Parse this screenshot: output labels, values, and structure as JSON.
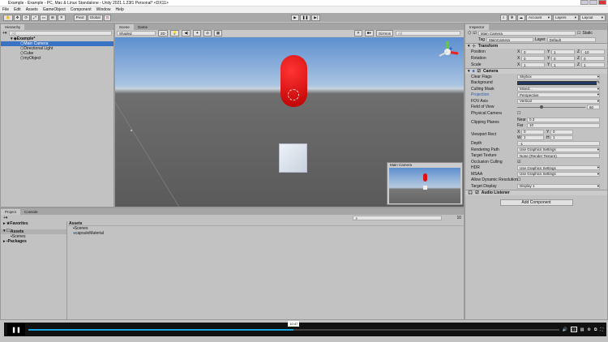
{
  "window": {
    "title": "Example - Example - PC, Mac & Linux Standalone - Unity 2021.1.23f1 Personal* <DX11>"
  },
  "menu": [
    "File",
    "Edit",
    "Assets",
    "GameObject",
    "Component",
    "Window",
    "Help"
  ],
  "toolbar": {
    "pivot": "Pivot",
    "global": "Global",
    "account": "Account",
    "layers": "Layers",
    "layout": "Layout"
  },
  "hierarchy": {
    "tab": "Hierarchy",
    "search": "All",
    "scene": "Example*",
    "items": [
      "Main Camera",
      "Directional Light",
      "Cube",
      "myObject"
    ],
    "selected": "Main Camera"
  },
  "scene": {
    "tabs": [
      "Scene",
      "Game"
    ],
    "shading": "Shaded",
    "mode2d": "2D",
    "gizmos": "Gizmos",
    "search": "All",
    "preview_title": "Main Camera"
  },
  "inspector": {
    "tab": "Inspector",
    "object_name": "Main Camera",
    "static": "Static",
    "tag_label": "Tag",
    "tag": "MainCamera",
    "layer_label": "Layer",
    "layer": "Default",
    "transform": {
      "title": "Transform",
      "rows": [
        {
          "label": "Position",
          "x": "0",
          "y": "1",
          "z": "-10"
        },
        {
          "label": "Rotation",
          "x": "0",
          "y": "0",
          "z": "0"
        },
        {
          "label": "Scale",
          "x": "1",
          "y": "1",
          "z": "1"
        }
      ]
    },
    "camera": {
      "title": "Camera",
      "clear_flags": "Clear Flags",
      "clear_flags_val": "Skybox",
      "background": "Background",
      "background_color": "#1f3b63",
      "culling_mask": "Culling Mask",
      "culling_mask_val": "Mixed...",
      "projection": "Projection",
      "projection_val": "Perspective",
      "fov_axis": "FOV Axis",
      "fov_axis_val": "Vertical",
      "fov": "Field of View",
      "fov_val": "60",
      "physical": "Physical Camera",
      "clipping": "Clipping Planes",
      "near_label": "Near",
      "near": "0.3",
      "far_label": "Far",
      "far": "10",
      "viewport": "Viewport Rect",
      "vx": "0",
      "vy": "0",
      "vw": "1",
      "vh": "1",
      "depth": "Depth",
      "depth_val": "-1",
      "rendering_path": "Rendering Path",
      "rendering_path_val": "Use Graphics Settings",
      "target_texture": "Target Texture",
      "target_texture_val": "None (Render Texture)",
      "occlusion": "Occlusion Culling",
      "hdr": "HDR",
      "hdr_val": "Use Graphics Settings",
      "msaa": "MSAA",
      "msaa_val": "Use Graphics Settings",
      "dynres": "Allow Dynamic Resolution",
      "target_display": "Target Display",
      "target_display_val": "Display 1"
    },
    "audio_listener": "Audio Listener",
    "add_component": "Add Component"
  },
  "project": {
    "tabs": [
      "Project",
      "Console"
    ],
    "favorites": "Favorites",
    "assets": "Assets",
    "scenes": "Scenes",
    "packages": "Packages",
    "breadcrumb": "Assets",
    "items": [
      "Scenes",
      "capsuleMaterial"
    ],
    "count": "10"
  },
  "video": {
    "time": "10:47",
    "progress": 0.5
  }
}
